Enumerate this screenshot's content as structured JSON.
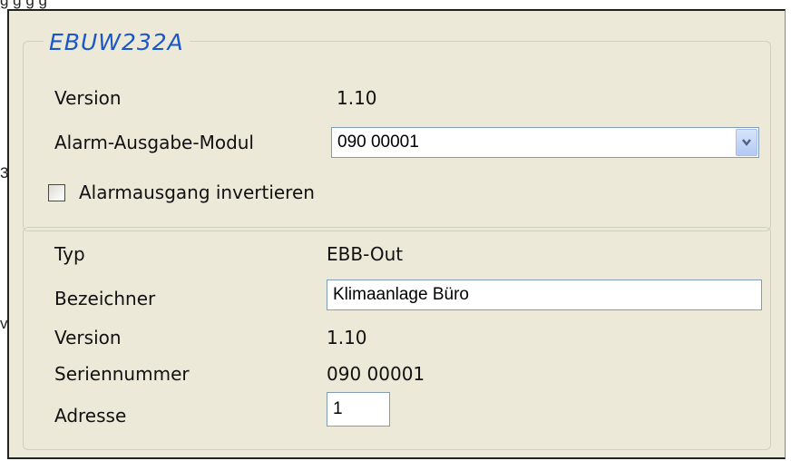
{
  "background_text": {
    "top_strip": "g                                              g                       g   g",
    "left_char_1": "3",
    "left_char_2": "v"
  },
  "device_group": {
    "title": "EBUW232A",
    "version_label": "Version",
    "version_value": "1.10",
    "alarm_module_label": "Alarm-Ausgabe-Modul",
    "alarm_module_value": "090 00001",
    "invert_checkbox_label": "Alarmausgang invertieren",
    "invert_checked": false
  },
  "module_group": {
    "type_label": "Typ",
    "type_value": "EBB-Out",
    "name_label": "Bezeichner",
    "name_value": "Klimaanlage Büro",
    "version_label": "Version",
    "version_value": "1.10",
    "serial_label": "Seriennummer",
    "serial_value": "090 00001",
    "address_label": "Adresse",
    "address_value": "1"
  },
  "colors": {
    "panel_bg": "#ece9d8",
    "title_blue": "#1a57c8",
    "input_border": "#7f9db9"
  }
}
